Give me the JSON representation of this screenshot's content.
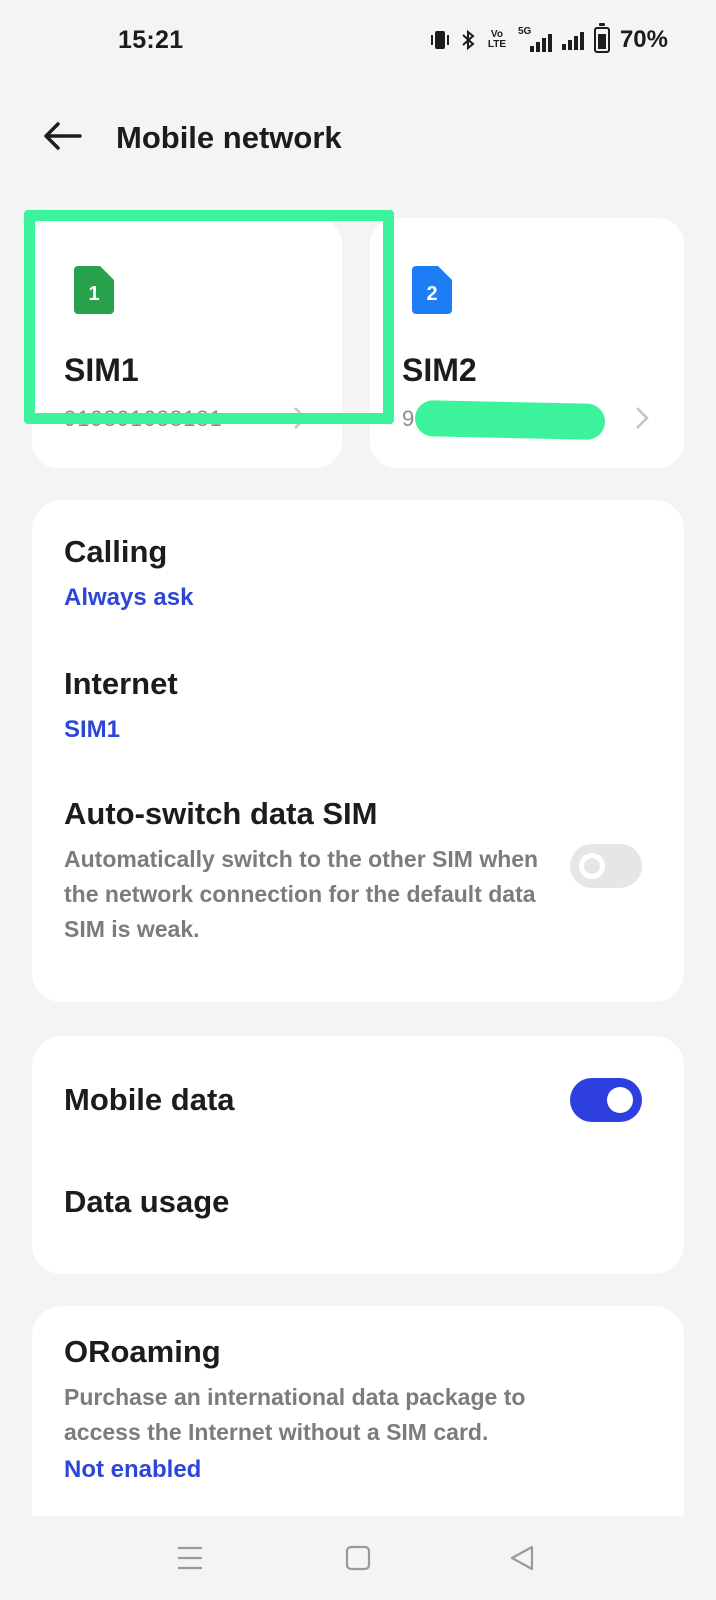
{
  "status": {
    "time": "15:21",
    "volte_label": "Vo LTE",
    "net_label": "5G",
    "battery": "70%"
  },
  "header": {
    "title": "Mobile network",
    "back_icon": "arrow-left-icon"
  },
  "sims": [
    {
      "name": "SIM1",
      "slot": "1",
      "number": "919891688181",
      "color": "#27a14b"
    },
    {
      "name": "SIM2",
      "slot": "2",
      "number": "9",
      "color": "#1e7df5"
    }
  ],
  "calling": {
    "title": "Calling",
    "value": "Always ask"
  },
  "internet": {
    "title": "Internet",
    "value": "SIM1"
  },
  "auto_switch": {
    "title": "Auto-switch data SIM",
    "description": "Automatically switch to the other SIM when the network connection for the default data SIM is weak.",
    "enabled": false
  },
  "mobile_data": {
    "title": "Mobile data",
    "enabled": true
  },
  "data_usage": {
    "title": "Data usage"
  },
  "oroaming": {
    "title": "ORoaming",
    "description": "Purchase an international data package to access the Internet without a SIM card.",
    "value": "Not enabled"
  },
  "colors": {
    "accent": "#2e3fe0",
    "link": "#2e46d6",
    "highlight": "#3cf29a"
  },
  "nav": {
    "menu_icon": "menu-icon",
    "home_icon": "home-square-icon",
    "back_icon": "back-triangle-icon"
  }
}
